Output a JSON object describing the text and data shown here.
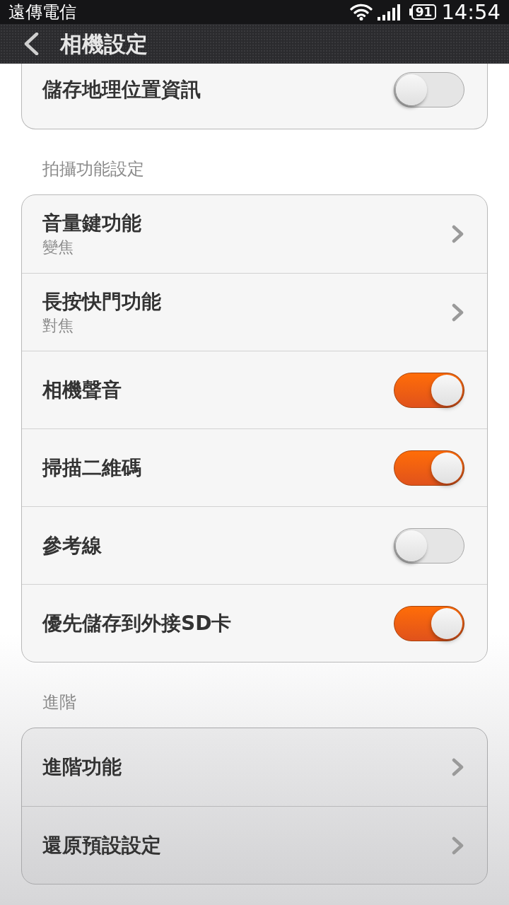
{
  "status_bar": {
    "carrier": "遠傳電信",
    "battery_text": "91",
    "time": "14:54"
  },
  "header": {
    "title": "相機設定"
  },
  "groups": [
    {
      "items": [
        {
          "kind": "toggle",
          "label": "儲存地理位置資訊",
          "on": false
        }
      ]
    },
    {
      "title": "拍攝功能設定",
      "items": [
        {
          "kind": "link",
          "label": "音量鍵功能",
          "value": "變焦"
        },
        {
          "kind": "link",
          "label": "長按快門功能",
          "value": "對焦"
        },
        {
          "kind": "toggle",
          "label": "相機聲音",
          "on": true
        },
        {
          "kind": "toggle",
          "label": "掃描二維碼",
          "on": true
        },
        {
          "kind": "toggle",
          "label": "參考線",
          "on": false
        },
        {
          "kind": "toggle",
          "label": "優先儲存到外接SD卡",
          "on": true
        }
      ]
    },
    {
      "title": "進階",
      "items": [
        {
          "kind": "link",
          "label": "進階功能"
        },
        {
          "kind": "link",
          "label": "還原預設設定"
        }
      ]
    }
  ]
}
